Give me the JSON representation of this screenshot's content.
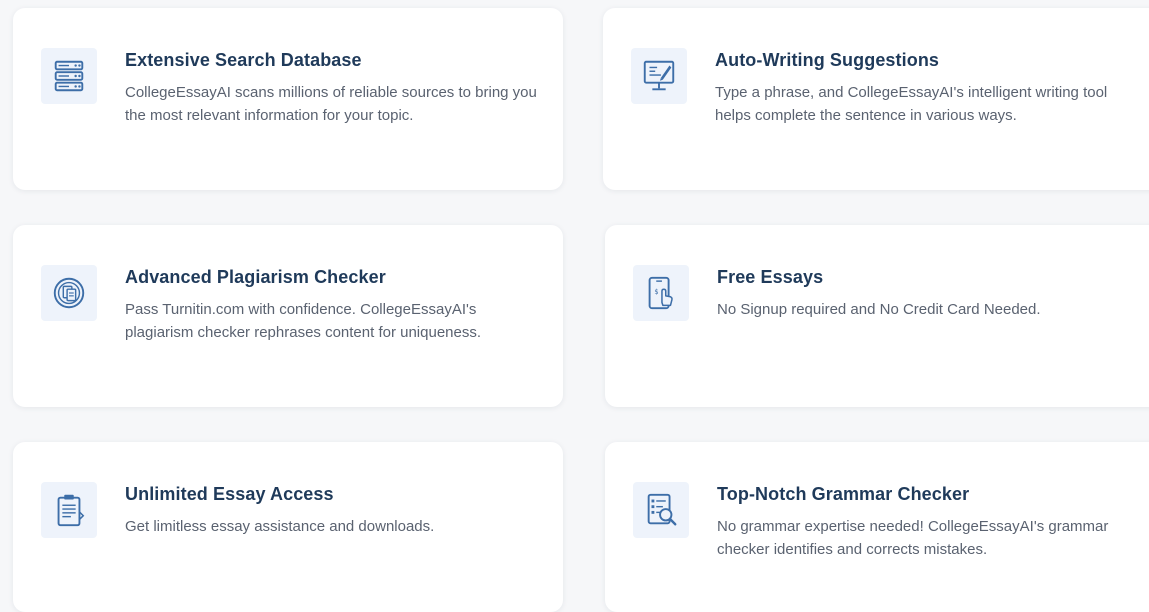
{
  "colors": {
    "title": "#1f3a5a",
    "description": "#5a6270",
    "icon_primary": "#3d6ea8",
    "icon_tile_bg": "#eef3fb",
    "card_bg": "#ffffff"
  },
  "features": [
    {
      "icon": "database-icon",
      "title": "Extensive Search Database",
      "description": "CollegeEssayAI scans millions of reliable sources to bring you the most relevant information for your topic."
    },
    {
      "icon": "auto-writing-monitor-icon",
      "title": "Auto-Writing Suggestions",
      "description": "Type a phrase, and CollegeEssayAI's intelligent writing tool helps complete the sentence in various ways."
    },
    {
      "icon": "plagiarism-checker-icon",
      "title": "Advanced Plagiarism Checker",
      "description": "Pass Turnitin.com with confidence. CollegeEssayAI's plagiarism checker rephrases content for uniqueness."
    },
    {
      "icon": "phone-tap-icon",
      "title": "Free Essays",
      "description": "No Signup required and No Credit Card Needed."
    },
    {
      "icon": "clipboard-icon",
      "title": "Unlimited Essay Access",
      "description": "Get limitless essay assistance and downloads."
    },
    {
      "icon": "grammar-magnifier-icon",
      "title": "Top-Notch Grammar Checker",
      "description": "No grammar expertise needed! CollegeEssayAI's grammar checker identifies and corrects mistakes."
    }
  ]
}
